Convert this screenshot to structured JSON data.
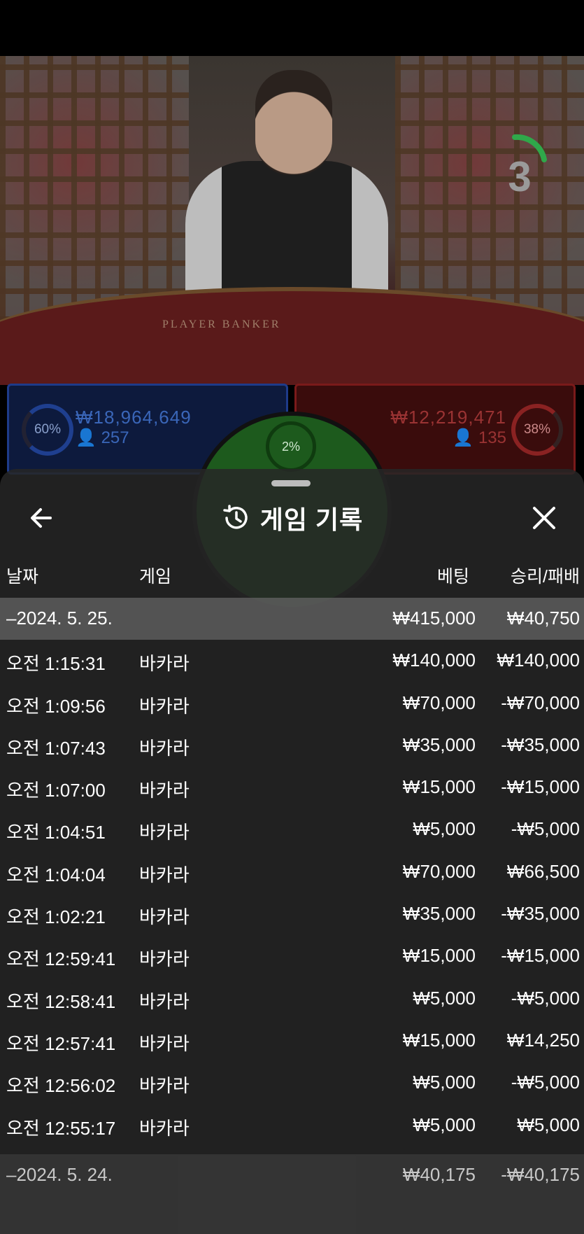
{
  "background": {
    "timer_count": "3",
    "table_text": "PLAYER        BANKER",
    "player": {
      "percent": "60%",
      "amount": "₩18,964,649",
      "count": "257"
    },
    "banker": {
      "percent": "38%",
      "amount": "₩12,219,471",
      "count": "135"
    },
    "tie": {
      "percent": "2%"
    }
  },
  "sheet": {
    "title": "게임 기록",
    "columns": {
      "date": "날짜",
      "game": "게임",
      "bet": "베팅",
      "result": "승리/패배"
    },
    "groups": [
      {
        "date": "–2024. 5. 25.",
        "bet_total": "₩415,000",
        "result_total": "₩40,750",
        "rows": [
          {
            "time": "오전 1:15:31",
            "game": "바카라",
            "bet": "₩140,000",
            "result": "₩140,000"
          },
          {
            "time": "오전 1:09:56",
            "game": "바카라",
            "bet": "₩70,000",
            "result": "-₩70,000"
          },
          {
            "time": "오전 1:07:43",
            "game": "바카라",
            "bet": "₩35,000",
            "result": "-₩35,000"
          },
          {
            "time": "오전 1:07:00",
            "game": "바카라",
            "bet": "₩15,000",
            "result": "-₩15,000"
          },
          {
            "time": "오전 1:04:51",
            "game": "바카라",
            "bet": "₩5,000",
            "result": "-₩5,000"
          },
          {
            "time": "오전 1:04:04",
            "game": "바카라",
            "bet": "₩70,000",
            "result": "₩66,500"
          },
          {
            "time": "오전 1:02:21",
            "game": "바카라",
            "bet": "₩35,000",
            "result": "-₩35,000"
          },
          {
            "time": "오전 12:59:41",
            "game": "바카라",
            "bet": "₩15,000",
            "result": "-₩15,000"
          },
          {
            "time": "오전 12:58:41",
            "game": "바카라",
            "bet": "₩5,000",
            "result": "-₩5,000"
          },
          {
            "time": "오전 12:57:41",
            "game": "바카라",
            "bet": "₩15,000",
            "result": "₩14,250"
          },
          {
            "time": "오전 12:56:02",
            "game": "바카라",
            "bet": "₩5,000",
            "result": "-₩5,000"
          },
          {
            "time": "오전 12:55:17",
            "game": "바카라",
            "bet": "₩5,000",
            "result": "₩5,000"
          }
        ]
      },
      {
        "date": "–2024. 5. 24.",
        "bet_total": "₩40,175",
        "result_total": "-₩40,175"
      }
    ]
  },
  "colors": {
    "player": "#1e3b8a",
    "banker": "#7a1a1a",
    "tie": "#1d5a1d",
    "timer_arc": "#2fa84a"
  }
}
